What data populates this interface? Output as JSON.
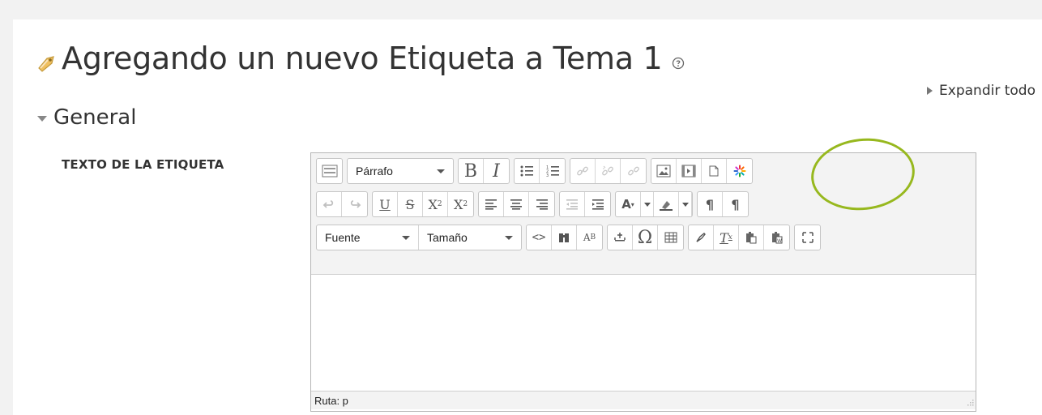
{
  "header": {
    "title": "Agregando un nuevo Etiqueta a Tema 1",
    "expand_all": "Expandir todo"
  },
  "section": {
    "title": "General"
  },
  "field": {
    "label": "TEXTO DE LA ETIQUETA"
  },
  "editor": {
    "paragraph_select": "Párrafo",
    "font_select": "Fuente",
    "size_select": "Tamaño",
    "status_path": "Ruta: p",
    "toolbar_row1": [
      "toggle-toolbar-icon",
      "bold-icon",
      "italic-icon",
      "bullet-list-icon",
      "numbered-list-icon",
      "link-icon",
      "unlink-icon",
      "anchor-icon",
      "image-icon",
      "media-icon",
      "manage-files-icon",
      "plugin-star-icon"
    ],
    "toolbar_row2": [
      "undo-icon",
      "redo-icon",
      "underline-icon",
      "strikethrough-icon",
      "subscript-icon",
      "superscript-icon",
      "align-left-icon",
      "align-center-icon",
      "align-right-icon",
      "outdent-icon",
      "indent-icon",
      "text-color-icon",
      "background-color-icon",
      "ltr-icon",
      "rtl-icon"
    ],
    "toolbar_row3": [
      "html-code-icon",
      "search-icon",
      "replace-icon",
      "anchor-char-icon",
      "special-char-icon",
      "table-icon",
      "clear-formatting-icon",
      "remove-format-icon",
      "paste-text-icon",
      "paste-word-icon",
      "fullscreen-icon"
    ]
  },
  "colors": {
    "highlight_ring": "#97b81e",
    "title_text": "#333333"
  }
}
